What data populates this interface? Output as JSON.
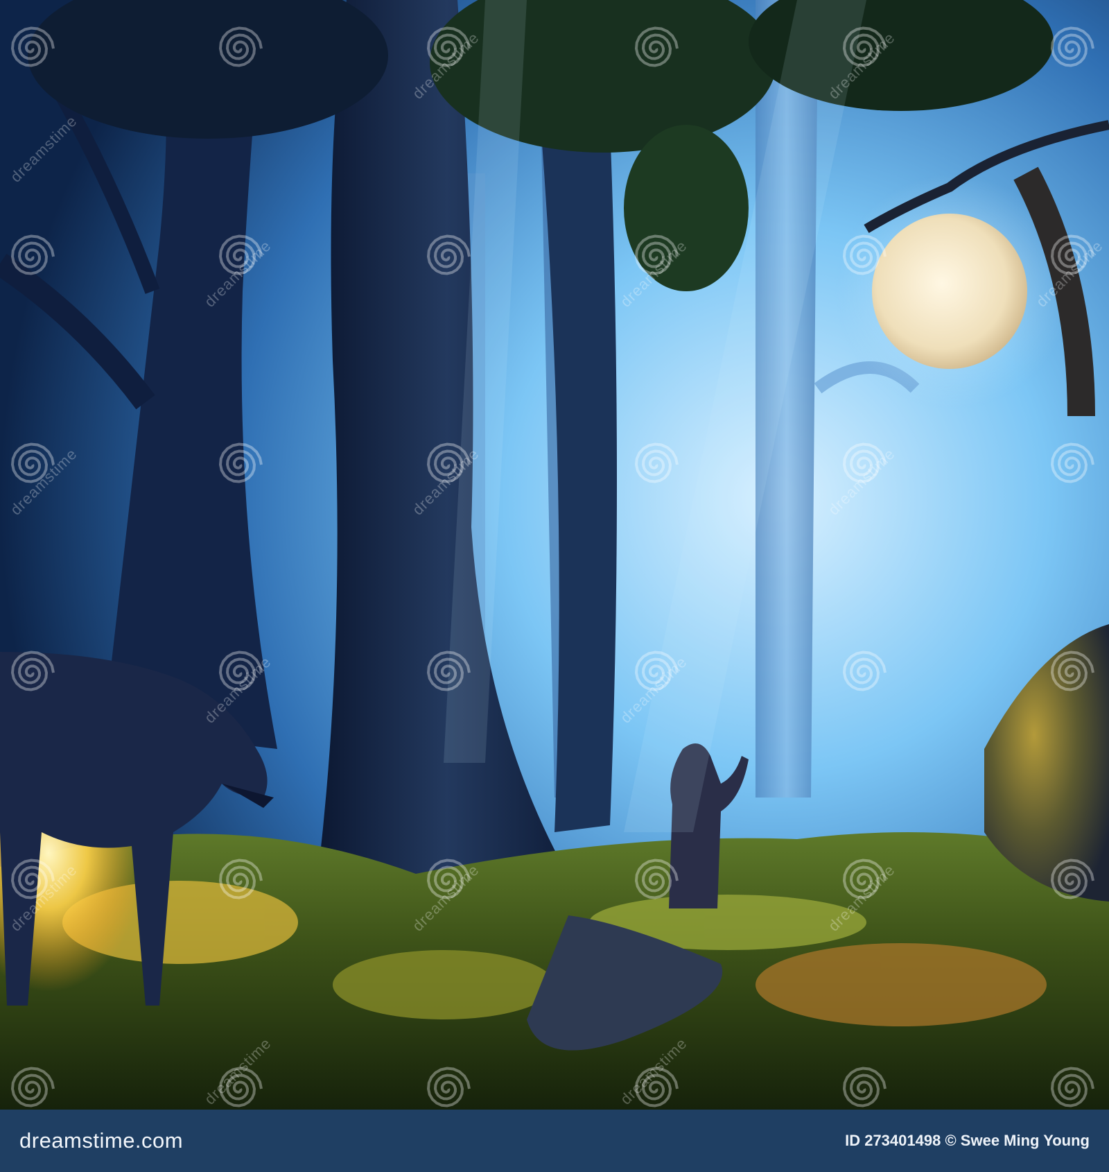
{
  "footer": {
    "site_logo": "dreamstime.com",
    "image_id_label": "ID 273401498",
    "copyright_symbol": "©",
    "author": "Swee Ming Young"
  },
  "watermark": {
    "text": "dreamstime",
    "icon": "spiral-swirl-icon"
  },
  "colors": {
    "sky_glow": "#8fd0ff",
    "deep_blue": "#0f2750",
    "moon": "#f3e7c8",
    "grass_gold": "#d8b53a",
    "footer_bg": "#1f3f63"
  }
}
